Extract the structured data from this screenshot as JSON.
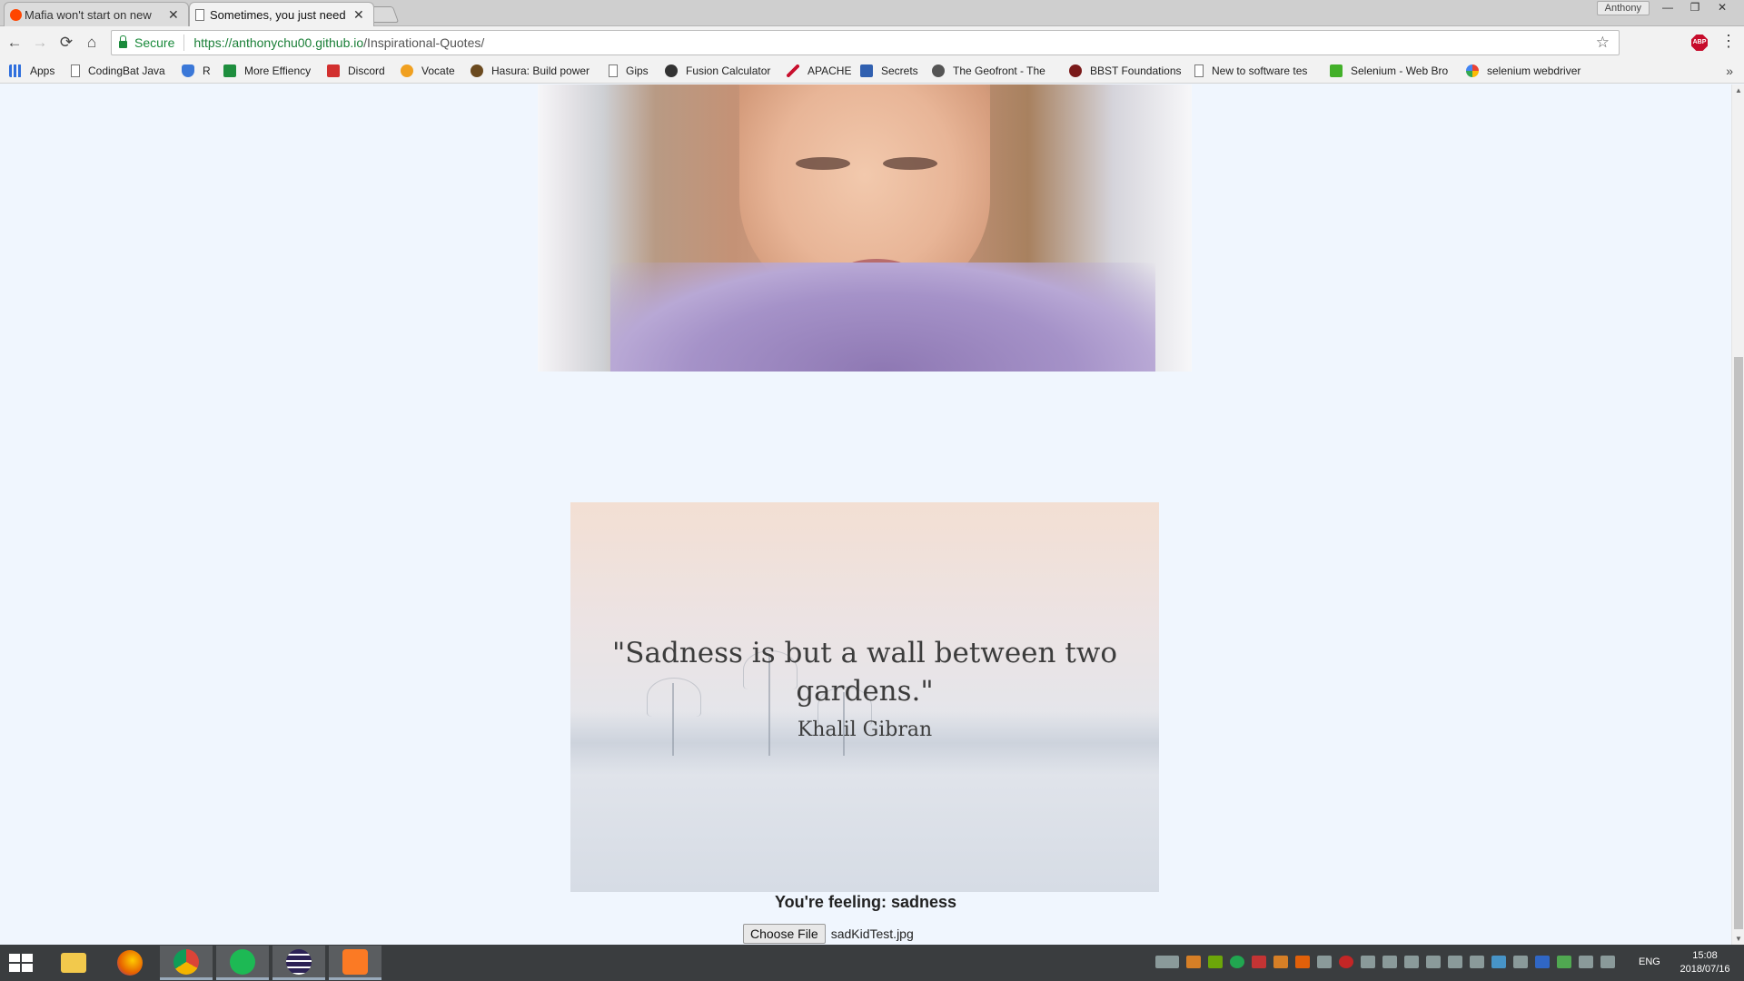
{
  "browser": {
    "tabs": [
      {
        "title": "Mafia won't start on new",
        "active": false,
        "icon": "reddit-icon"
      },
      {
        "title": "Sometimes, you just need",
        "active": true,
        "icon": "page-icon"
      }
    ],
    "profile": "Anthony",
    "window_controls": {
      "minimize": "—",
      "restore": "❐",
      "close": "✕"
    },
    "tab_close": "✕",
    "omnibox": {
      "secure_label": "Secure",
      "url_host": "https://anthonychu00.github.io",
      "url_path": "/Inspirational-Quotes/"
    },
    "nav": {
      "back": "←",
      "forward": "→",
      "reload": "⟳",
      "home": "⌂",
      "star": "☆",
      "menu": "⋮",
      "abp": "ABP"
    }
  },
  "bookmarks": [
    {
      "label": "Apps",
      "icon": "apps-grid-icon",
      "color": "#2f6fdd"
    },
    {
      "label": "CodingBat Java",
      "icon": "page-icon",
      "color": "#ffffff"
    },
    {
      "label": "R",
      "icon": "shield-icon",
      "color": "#3b78d8"
    },
    {
      "label": "More Effiency",
      "icon": "sheets-icon",
      "color": "#1e8e3e"
    },
    {
      "label": "Discord",
      "icon": "discord-icon",
      "color": "#d2302f"
    },
    {
      "label": "Vocate",
      "icon": "vocate-icon",
      "color": "#f0a020"
    },
    {
      "label": "Hasura: Build power",
      "icon": "hasura-icon",
      "color": "#6b4a1f"
    },
    {
      "label": "Gips",
      "icon": "page-icon",
      "color": "#ffffff"
    },
    {
      "label": "Fusion Calculator",
      "icon": "fusion-icon",
      "color": "#333333"
    },
    {
      "label": "APACHE",
      "icon": "apache-feather-icon",
      "color": "#c8102e"
    },
    {
      "label": "Secrets",
      "icon": "secrets-icon",
      "color": "#3060b0"
    },
    {
      "label": "The Geofront - The",
      "icon": "geofront-icon",
      "color": "#555555"
    },
    {
      "label": "BBST Foundations",
      "icon": "bbst-icon",
      "color": "#7a1a1a"
    },
    {
      "label": "New to software tes",
      "icon": "page-icon",
      "color": "#ffffff"
    },
    {
      "label": "Selenium - Web Bro",
      "icon": "selenium-icon",
      "color": "#43b02a"
    },
    {
      "label": "selenium webdriver",
      "icon": "google-icon",
      "color": "#4285f4"
    }
  ],
  "bookmarks_more": "»",
  "page": {
    "quote": "\"Sadness is but a wall between two gardens.\"",
    "author": "Khalil Gibran",
    "feeling_label": "You're feeling: sadness",
    "file_button": "Choose File",
    "file_name": "sadKidTest.jpg"
  },
  "scroll": {
    "up": "▲",
    "down": "▼"
  },
  "taskbar": {
    "apps": [
      {
        "name": "file-explorer",
        "color": "#f2c94c"
      },
      {
        "name": "firefox",
        "color": "#e66000"
      },
      {
        "name": "chrome",
        "color": "#4caf50"
      },
      {
        "name": "spotify",
        "color": "#1db954"
      },
      {
        "name": "eclipse",
        "color": "#2c2255"
      },
      {
        "name": "xampp",
        "color": "#fb7a24"
      }
    ],
    "language": "ENG",
    "time": "15:08",
    "date": "2018/07/16"
  }
}
